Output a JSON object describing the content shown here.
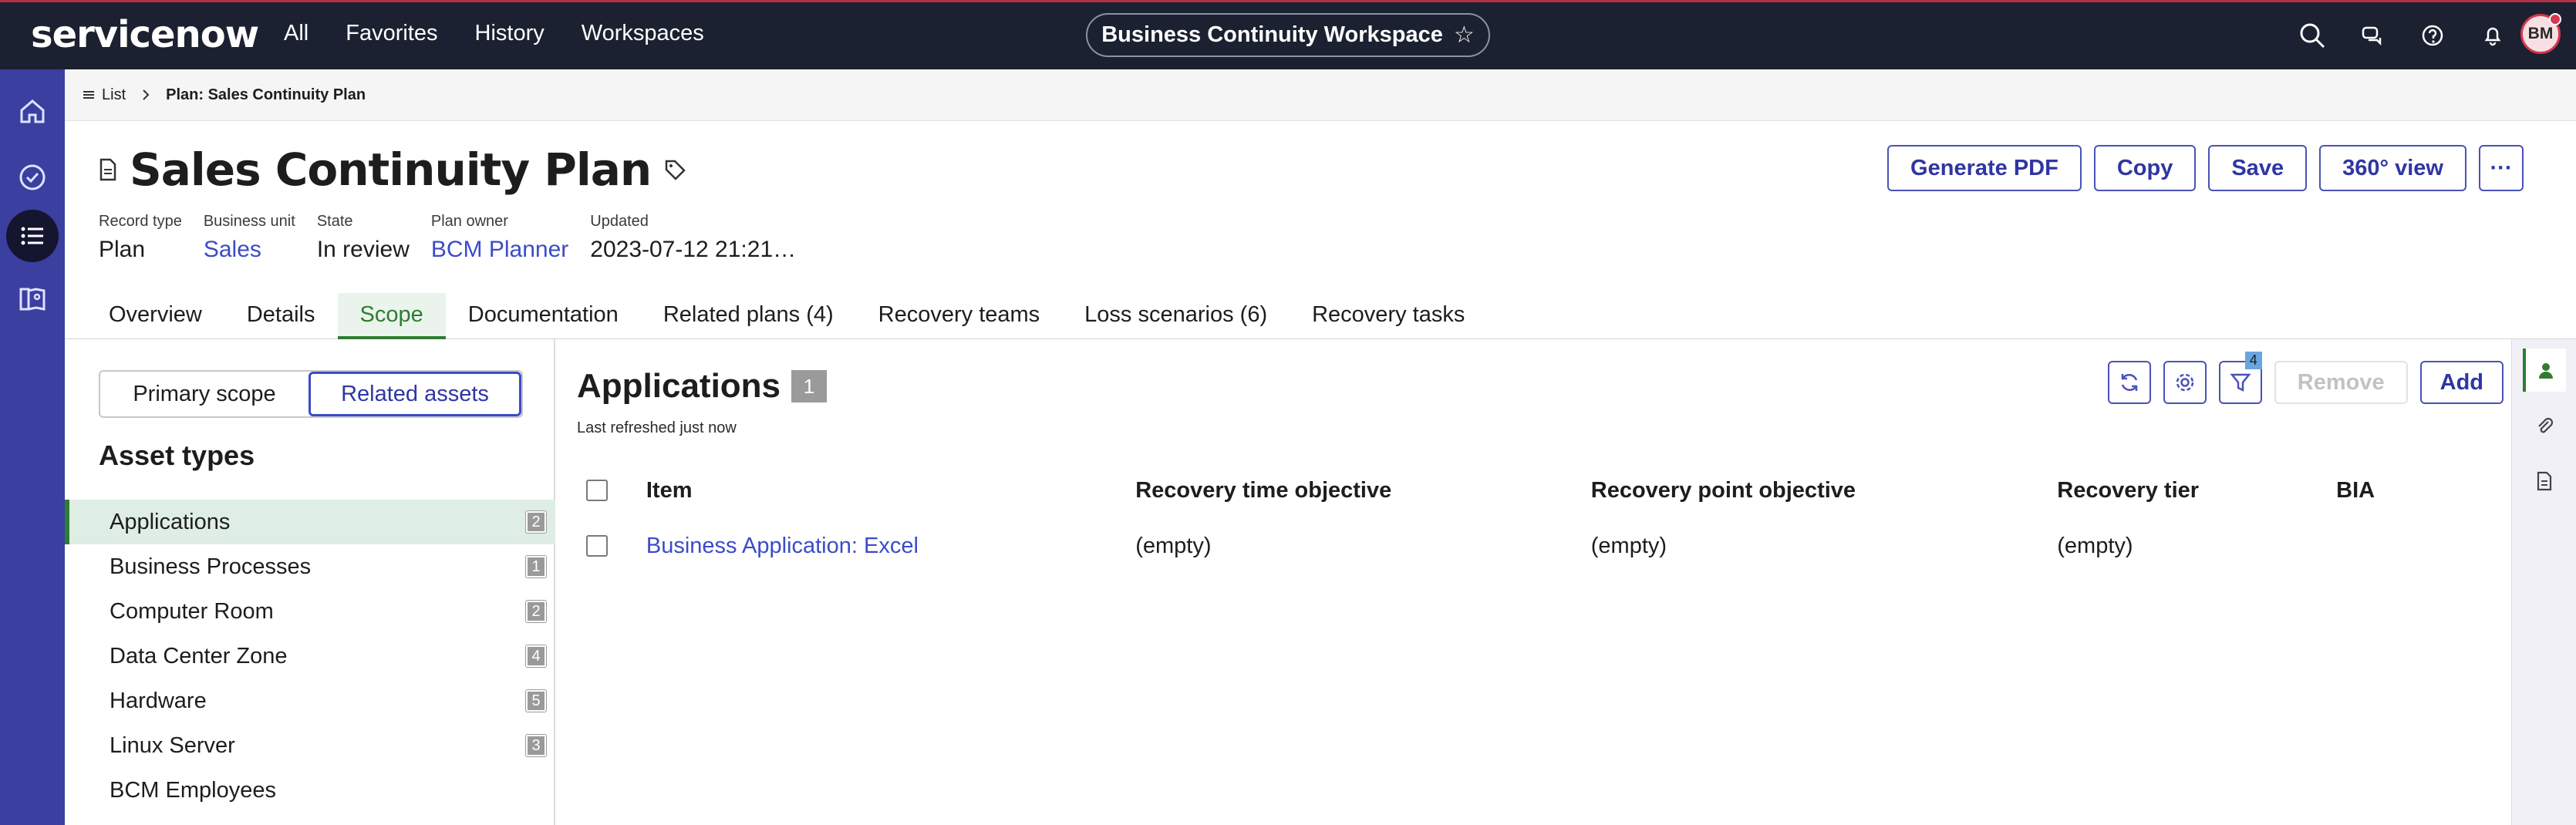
{
  "header": {
    "logo": "servicenow",
    "nav": [
      "All",
      "Favorites",
      "History",
      "Workspaces"
    ],
    "workspace_pill": "Business Continuity Workspace",
    "star_glyph": "☆",
    "avatar_initials": "BM",
    "icons": [
      "search-icon",
      "chat-icon",
      "help-icon",
      "bell-icon"
    ]
  },
  "rail": {
    "icons": [
      "home-icon",
      "check-circle-icon",
      "list-icon",
      "map-book-icon"
    ],
    "active_index": 2
  },
  "breadcrumb": {
    "list_label": "List",
    "current": "Plan: Sales Continuity Plan"
  },
  "record": {
    "title": "Sales Continuity Plan",
    "meta": [
      {
        "key": "Record type",
        "value": "Plan",
        "is_link": false
      },
      {
        "key": "Business unit",
        "value": "Sales",
        "is_link": true
      },
      {
        "key": "State",
        "value": "In review",
        "is_link": false
      },
      {
        "key": "Plan owner",
        "value": "BCM Planner",
        "is_link": true
      },
      {
        "key": "Updated",
        "value": "2023-07-12 21:21…",
        "is_link": false
      }
    ],
    "actions": [
      "Generate PDF",
      "Copy",
      "Save",
      "360° view"
    ],
    "more_label": "···"
  },
  "tabs": {
    "items": [
      "Overview",
      "Details",
      "Scope",
      "Documentation",
      "Related plans (4)",
      "Recovery teams",
      "Loss scenarios (6)",
      "Recovery tasks"
    ],
    "active": "Scope"
  },
  "left_panel": {
    "segment": [
      "Primary scope",
      "Related assets"
    ],
    "segment_selected": "Related assets",
    "asset_types_title": "Asset types",
    "assets": [
      {
        "label": "Applications",
        "count": "2"
      },
      {
        "label": "Business Processes",
        "count": "1"
      },
      {
        "label": "Computer Room",
        "count": "2"
      },
      {
        "label": "Data Center Zone",
        "count": "4"
      },
      {
        "label": "Hardware",
        "count": "5"
      },
      {
        "label": "Linux Server",
        "count": "3"
      },
      {
        "label": "BCM Employees",
        "count": ""
      }
    ],
    "selected_asset": "Applications"
  },
  "main": {
    "title": "Applications",
    "count": "1",
    "refreshed": "Last refreshed just now",
    "filter_badge": "4",
    "remove_label": "Remove",
    "add_label": "Add",
    "columns": [
      "Item",
      "Recovery time objective",
      "Recovery point objective",
      "Recovery tier",
      "BIA"
    ],
    "rows": [
      [
        "Business Application: Excel",
        "(empty)",
        "(empty)",
        "(empty)",
        ""
      ]
    ]
  },
  "right_sidebar": {
    "icons": [
      "person-icon",
      "paperclip-icon",
      "document-icon"
    ]
  },
  "colors": {
    "header_bg": "#1b2130",
    "rail_bg": "#3b3fa0",
    "accent_green": "#2e7d32",
    "link_blue": "#3b4bc8"
  }
}
